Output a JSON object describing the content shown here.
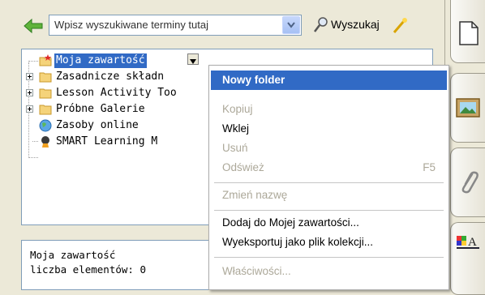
{
  "search": {
    "placeholder": "Wpisz wyszukiwane terminy tutaj",
    "button_label": "Wyszukaj"
  },
  "tree": {
    "items": [
      {
        "label": "Moja zawartość",
        "icon": "folder-star-icon",
        "selected": true
      },
      {
        "label": "Zasadnicze składn",
        "icon": "folder-icon",
        "expandable": true
      },
      {
        "label": "Lesson Activity Too",
        "icon": "folder-icon",
        "expandable": true
      },
      {
        "label": "Próbne Galerie",
        "icon": "folder-icon",
        "expandable": true
      },
      {
        "label": "Zasoby online",
        "icon": "globe-icon"
      },
      {
        "label": "SMART Learning M",
        "icon": "smart-learning-icon"
      }
    ]
  },
  "status": {
    "line1": "Moja zawartość",
    "line2": "liczba elementów: 0"
  },
  "context_menu": {
    "items": [
      {
        "label": "Nowy folder",
        "highlighted": true
      },
      {
        "label": "Kopiuj",
        "disabled": true
      },
      {
        "label": "Wklej"
      },
      {
        "label": "Usuń",
        "disabled": true
      },
      {
        "label": "Odśwież",
        "shortcut": "F5",
        "disabled": true
      },
      {
        "label": "Zmień nazwę",
        "disabled": true
      },
      {
        "label": "Dodaj do Mojej zawartości..."
      },
      {
        "label": "Wyeksportuj jako plik kolekcji..."
      },
      {
        "label": "Właściwości...",
        "disabled": true
      }
    ]
  },
  "side_tabs": [
    "page-sorter-icon",
    "gallery-icon",
    "attachments-icon",
    "properties-icon"
  ],
  "colors": {
    "highlight": "#316ac5",
    "disabled_text": "#aca899",
    "panel_bg": "#ece9d8"
  }
}
